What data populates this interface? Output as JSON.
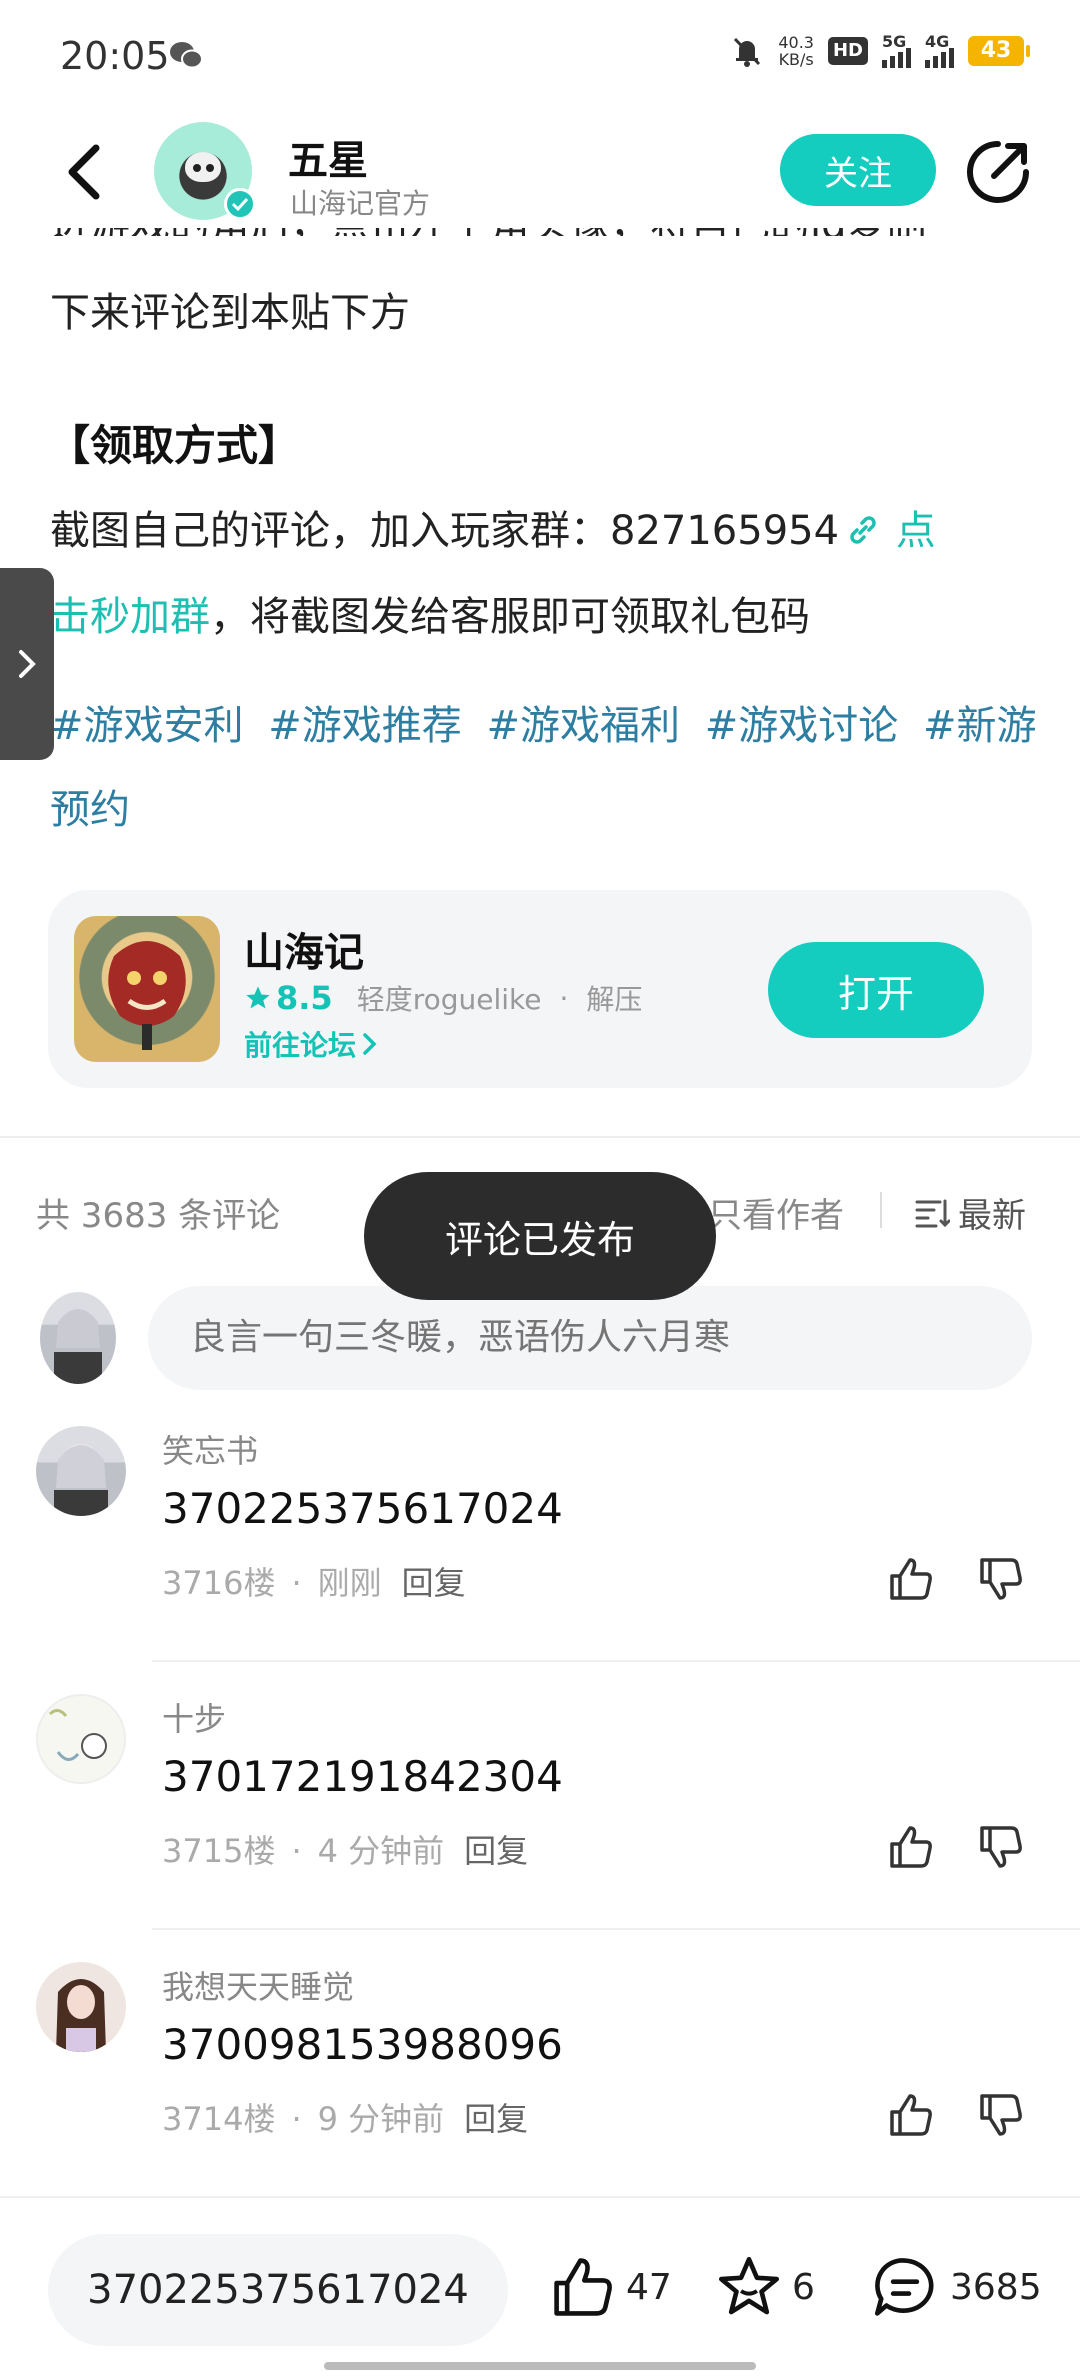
{
  "status_bar": {
    "time": "20:05",
    "net_speed_value": "40.3",
    "net_speed_unit": "KB/s",
    "hd_label": "HD",
    "signal1_label": "5G",
    "signal2_label": "4G",
    "battery": "43"
  },
  "header": {
    "author_name": "五星",
    "author_subtitle": "山海记官方",
    "follow_label": "关注"
  },
  "article": {
    "cut_line": "进游戏的角后，点击左上角头像，将自己的id复制",
    "line_continue": "下来评论到本贴下方",
    "section_title": "【领取方式】",
    "method_text_1": "截图自己的评论，加入玩家群：827165954",
    "method_link_a": " 点",
    "method_link_b": "击秒加群",
    "method_text_2": "，将截图发给客服即可领取礼包码",
    "tags": [
      "#游戏安利",
      "#游戏推荐",
      "#游戏福利",
      "#游戏讨论",
      "#新游预约"
    ]
  },
  "game_card": {
    "name": "山海记",
    "rating": "8.5",
    "genre": "轻度roguelike",
    "tag": "解压",
    "forum_link": "前往论坛",
    "open_label": "打开"
  },
  "comments_header": {
    "count_text": "共 3683 条评论",
    "only_author": "只看作者",
    "sort_label": "最新"
  },
  "toast": "评论已发布",
  "comment_input_placeholder": "良言一句三冬暖，恶语伤人六月寒",
  "comments": [
    {
      "user": "笑忘书",
      "text": "370225375617024",
      "floor": "3716楼",
      "time": "刚刚",
      "reply": "回复"
    },
    {
      "user": "十步",
      "text": "370172191842304",
      "floor": "3715楼",
      "time": "4 分钟前",
      "reply": "回复"
    },
    {
      "user": "我想天天睡觉",
      "text": "370098153988096",
      "floor": "3714楼",
      "time": "9 分钟前",
      "reply": "回复"
    }
  ],
  "bottom_bar": {
    "input_text": "370225375617024",
    "likes": "47",
    "favorites": "6",
    "comments": "3685"
  },
  "colors": {
    "accent": "#14cdbf",
    "tag_blue": "#2e7ea1",
    "toast_bg": "#2c2c2c"
  }
}
